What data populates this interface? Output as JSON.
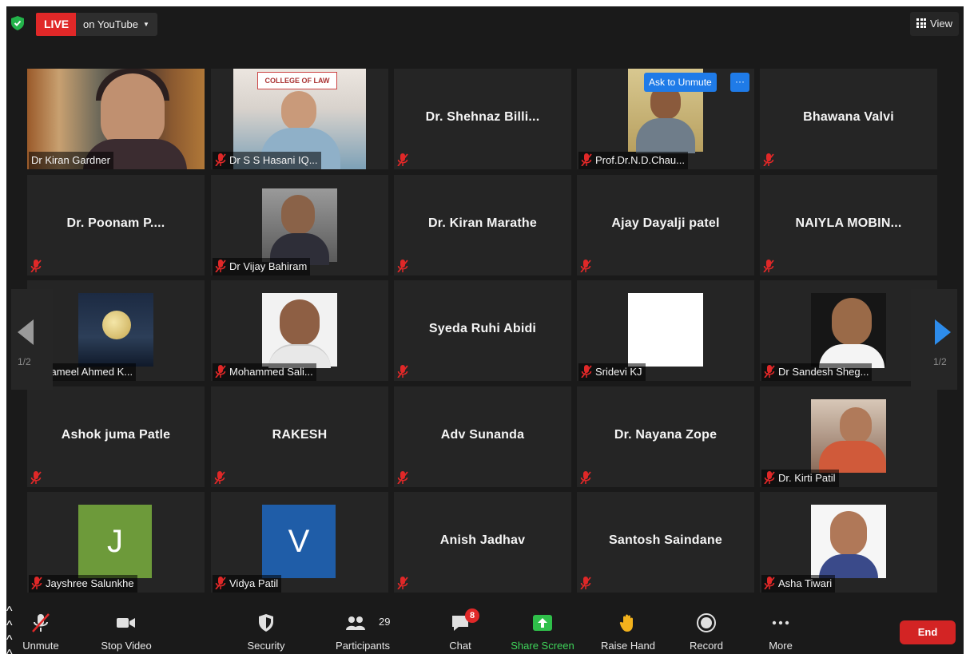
{
  "topbar": {
    "live_label": "LIVE",
    "stream_label": "on YouTube",
    "view_label": "View"
  },
  "pager": {
    "prev_label": "1/2",
    "next_label": "1/2"
  },
  "ask_unmute": "Ask to Unmute",
  "ask_more": "···",
  "tiles": [
    {
      "name": "Dr Kiran Gardner",
      "label": "Dr Kiran Gardner",
      "kind": "photo"
    },
    {
      "name": "Dr S S Hasani IQ...",
      "label": "Dr S S Hasani IQ...",
      "kind": "photo",
      "banner": "COLLEGE OF LAW"
    },
    {
      "name": "Dr. Shehnaz Billi...",
      "kind": "name"
    },
    {
      "name": "Prof.Dr.N.D.Chau...",
      "label": "Prof.Dr.N.D.Chau...",
      "kind": "photo"
    },
    {
      "name": "Bhawana Valvi",
      "kind": "name"
    },
    {
      "name": "Dr. Poonam P....",
      "kind": "name"
    },
    {
      "name": "Dr Vijay Bahiram",
      "label": "Dr Vijay Bahiram",
      "kind": "photo"
    },
    {
      "name": "Dr. Kiran Marathe",
      "kind": "name"
    },
    {
      "name": "Ajay Dayalji patel",
      "kind": "name"
    },
    {
      "name": "NAIYLA MOBIN...",
      "kind": "name"
    },
    {
      "name": "Jameel Ahmed K...",
      "label": "Jameel Ahmed K...",
      "kind": "photo"
    },
    {
      "name": "Mohammed Sali...",
      "label": "Mohammed Sali...",
      "kind": "photo"
    },
    {
      "name": "Syeda Ruhi Abidi",
      "kind": "name"
    },
    {
      "name": "Sridevi KJ",
      "label": "Sridevi KJ",
      "kind": "photo"
    },
    {
      "name": "Dr Sandesh Sheg...",
      "label": "Dr Sandesh Sheg...",
      "kind": "photo"
    },
    {
      "name": "Ashok juma Patle",
      "kind": "name"
    },
    {
      "name": "RAKESH",
      "kind": "name"
    },
    {
      "name": "Adv Sunanda",
      "kind": "name"
    },
    {
      "name": "Dr. Nayana Zope",
      "kind": "name"
    },
    {
      "name": "Dr. Kirti Patil",
      "label": "Dr. Kirti Patil",
      "kind": "photo"
    },
    {
      "name": "Jayshree Salunkhe",
      "label": "Jayshree Salunkhe",
      "kind": "avatar",
      "initial": "J",
      "color": "#6d9a3a"
    },
    {
      "name": "Vidya Patil",
      "label": "Vidya Patil",
      "kind": "avatar",
      "initial": "V",
      "color": "#1f5da8"
    },
    {
      "name": "Anish Jadhav",
      "kind": "name"
    },
    {
      "name": "Santosh Saindane",
      "kind": "name"
    },
    {
      "name": "Asha Tiwari",
      "label": "Asha Tiwari",
      "kind": "photo"
    }
  ],
  "toolbar": {
    "unmute": "Unmute",
    "stop_video": "Stop Video",
    "security": "Security",
    "participants": "Participants",
    "participant_count": "29",
    "chat": "Chat",
    "chat_badge": "8",
    "share_screen": "Share Screen",
    "raise_hand": "Raise Hand",
    "record": "Record",
    "more": "More",
    "end": "End"
  },
  "colors": {
    "live": "#e02828",
    "active_speaker": "#c8e86a",
    "share_screen": "#2fbf4a",
    "ask_button": "#1f7be8",
    "end_button": "#d32424",
    "muted_mic": "#e02828"
  }
}
